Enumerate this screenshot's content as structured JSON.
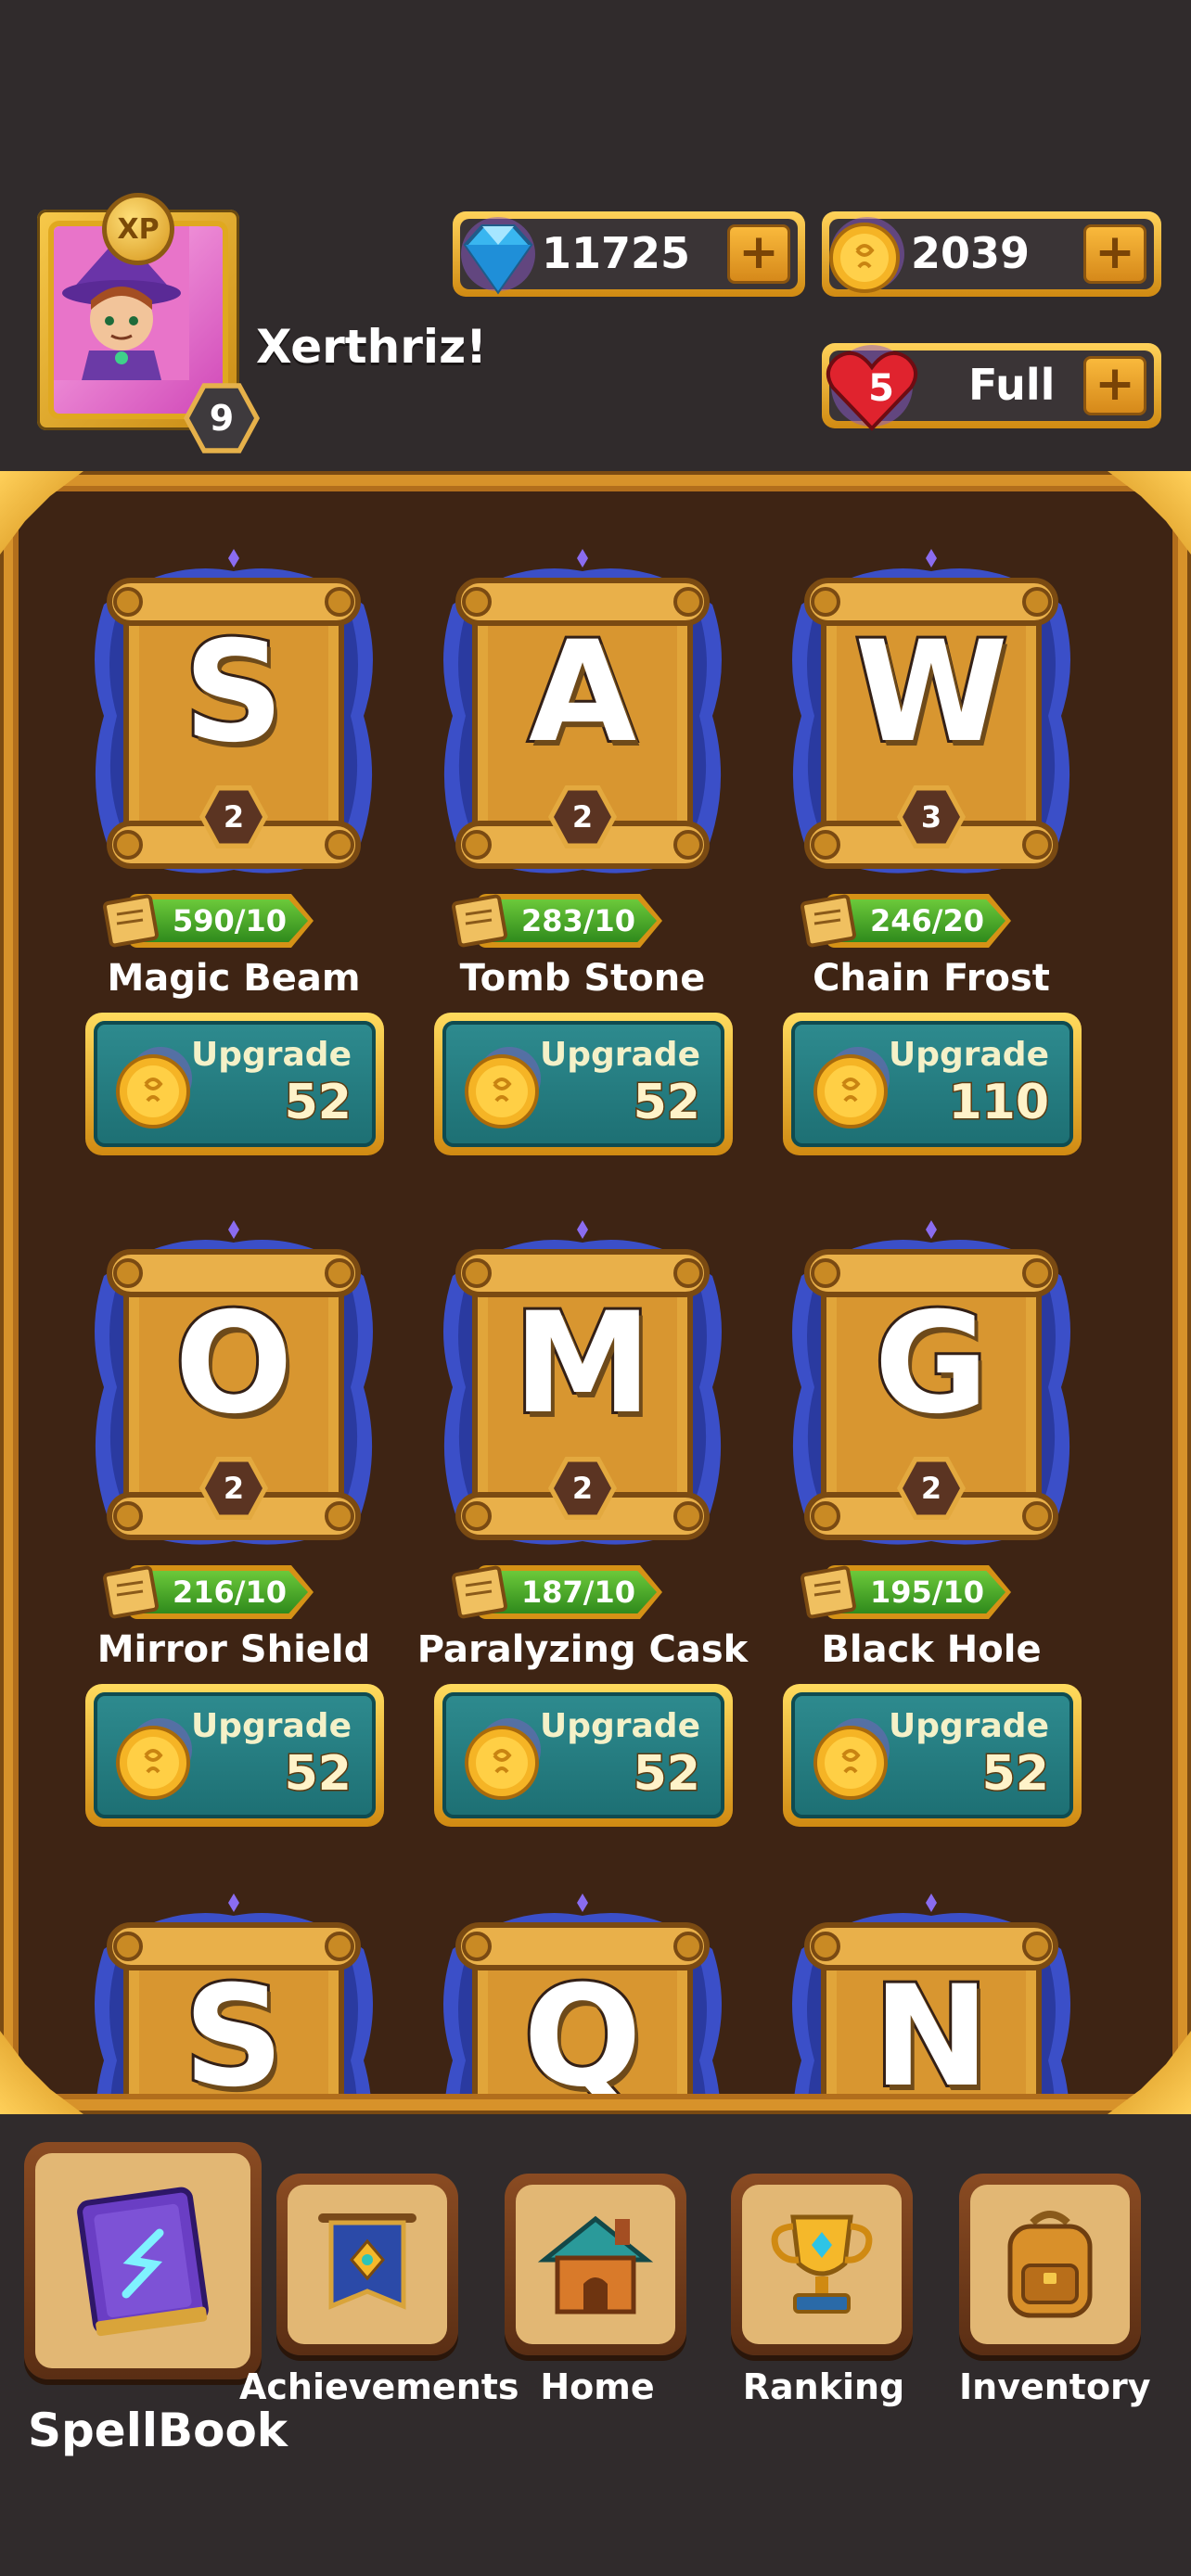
{
  "header": {
    "xp_label": "XP",
    "player_level": "9",
    "player_name": "Xerthriz!",
    "gems": "11725",
    "coins": "2039",
    "lives_count": "5",
    "lives_status": "Full",
    "plus_label": "+"
  },
  "spells": [
    {
      "glyph": "S",
      "level": "2",
      "progress": "590/10",
      "name": "Magic Beam",
      "upgrade_label": "Upgrade",
      "price": "52"
    },
    {
      "glyph": "A",
      "level": "2",
      "progress": "283/10",
      "name": "Tomb Stone",
      "upgrade_label": "Upgrade",
      "price": "52"
    },
    {
      "glyph": "W",
      "level": "3",
      "progress": "246/20",
      "name": "Chain Frost",
      "upgrade_label": "Upgrade",
      "price": "110"
    },
    {
      "glyph": "O",
      "level": "2",
      "progress": "216/10",
      "name": "Mirror Shield",
      "upgrade_label": "Upgrade",
      "price": "52"
    },
    {
      "glyph": "M",
      "level": "2",
      "progress": "187/10",
      "name": "Paralyzing Cask",
      "upgrade_label": "Upgrade",
      "price": "52"
    },
    {
      "glyph": "G",
      "level": "2",
      "progress": "195/10",
      "name": "Black Hole",
      "upgrade_label": "Upgrade",
      "price": "52"
    },
    {
      "glyph": "S",
      "level": "",
      "progress": "",
      "name": "",
      "upgrade_label": "",
      "price": ""
    },
    {
      "glyph": "Q",
      "level": "",
      "progress": "",
      "name": "",
      "upgrade_label": "",
      "price": ""
    },
    {
      "glyph": "N",
      "level": "",
      "progress": "",
      "name": "",
      "upgrade_label": "",
      "price": ""
    }
  ],
  "nav": {
    "spellbook": "SpellBook",
    "achievements": "Achievements",
    "home": "Home",
    "ranking": "Ranking",
    "inventory": "Inventory",
    "active": "spellbook"
  },
  "colors": {
    "background": "#302b2c",
    "gold": "#f5b82a",
    "board": "#3e2414",
    "upgrade_teal": "#1d6f73",
    "progress_green": "#4caf2a"
  }
}
